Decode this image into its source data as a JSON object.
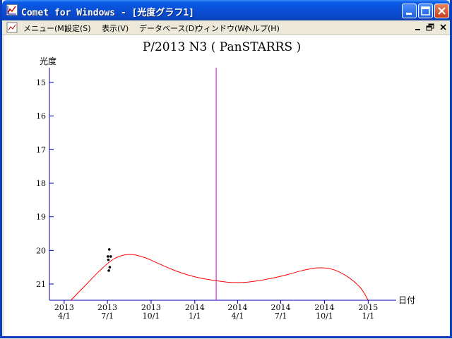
{
  "window": {
    "title": "Comet for Windows - [光度グラフ1]",
    "icon": "graph-icon",
    "controls": {
      "minimize": "minimize-icon",
      "maximize": "maximize-icon",
      "close": "close-icon"
    }
  },
  "menubar": {
    "items": [
      {
        "label": "メニュー(M)"
      },
      {
        "label": "設定(S)"
      },
      {
        "label": "表示(V)"
      },
      {
        "label": "データベース(D)"
      },
      {
        "label": "ウィンドウ(W)"
      },
      {
        "label": "ヘルプ(H)"
      }
    ],
    "mdi_controls": {
      "minimize": "mdi-minimize-icon",
      "restore": "mdi-restore-icon",
      "close": "mdi-close-icon"
    }
  },
  "colors": {
    "axis": "#0000aa",
    "curve": "#ff0000",
    "marker": "#cc00cc",
    "points": "#000000",
    "title_bar": "#0a4fd6"
  },
  "chart_data": {
    "type": "line",
    "title": "P/2013 N3 ( PanSTARRS )",
    "ylabel": "光度",
    "xlabel": "日付",
    "y_inverted": true,
    "ylim": [
      15,
      21.5
    ],
    "yticks": [
      15,
      16,
      17,
      18,
      19,
      20,
      21
    ],
    "xlim": [
      "2013-03-01",
      "2015-03-01"
    ],
    "xticks": [
      {
        "x": "2013-04-01",
        "line1": "2013",
        "line2": "4/1"
      },
      {
        "x": "2013-07-01",
        "line1": "2013",
        "line2": "7/1"
      },
      {
        "x": "2013-10-01",
        "line1": "2013",
        "line2": "10/1"
      },
      {
        "x": "2014-01-01",
        "line1": "2014",
        "line2": "1/1"
      },
      {
        "x": "2014-04-01",
        "line1": "2014",
        "line2": "4/1"
      },
      {
        "x": "2014-07-01",
        "line1": "2014",
        "line2": "7/1"
      },
      {
        "x": "2014-10-01",
        "line1": "2014",
        "line2": "10/1"
      },
      {
        "x": "2015-01-01",
        "line1": "2015",
        "line2": "1/1"
      }
    ],
    "marker_date": "2014-02-15",
    "curve": [
      {
        "x": "2013-04-15",
        "y": 21.5
      },
      {
        "x": "2013-05-15",
        "y": 21.05
      },
      {
        "x": "2013-06-15",
        "y": 20.6
      },
      {
        "x": "2013-07-15",
        "y": 20.25
      },
      {
        "x": "2013-08-15",
        "y": 20.12
      },
      {
        "x": "2013-09-15",
        "y": 20.2
      },
      {
        "x": "2013-10-15",
        "y": 20.38
      },
      {
        "x": "2013-11-15",
        "y": 20.57
      },
      {
        "x": "2013-12-15",
        "y": 20.72
      },
      {
        "x": "2014-01-15",
        "y": 20.83
      },
      {
        "x": "2014-02-15",
        "y": 20.9
      },
      {
        "x": "2014-03-15",
        "y": 20.95
      },
      {
        "x": "2014-04-15",
        "y": 20.95
      },
      {
        "x": "2014-05-15",
        "y": 20.9
      },
      {
        "x": "2014-06-15",
        "y": 20.82
      },
      {
        "x": "2014-07-15",
        "y": 20.72
      },
      {
        "x": "2014-08-15",
        "y": 20.6
      },
      {
        "x": "2014-09-15",
        "y": 20.52
      },
      {
        "x": "2014-10-15",
        "y": 20.55
      },
      {
        "x": "2014-11-15",
        "y": 20.75
      },
      {
        "x": "2014-12-15",
        "y": 21.1
      },
      {
        "x": "2015-01-01",
        "y": 21.5
      }
    ],
    "observations": [
      {
        "x": "2013-07-05",
        "y": 19.97
      },
      {
        "x": "2013-07-02",
        "y": 20.18
      },
      {
        "x": "2013-07-08",
        "y": 20.18
      },
      {
        "x": "2013-07-03",
        "y": 20.28
      },
      {
        "x": "2013-07-06",
        "y": 20.5
      },
      {
        "x": "2013-07-04",
        "y": 20.6
      }
    ]
  }
}
